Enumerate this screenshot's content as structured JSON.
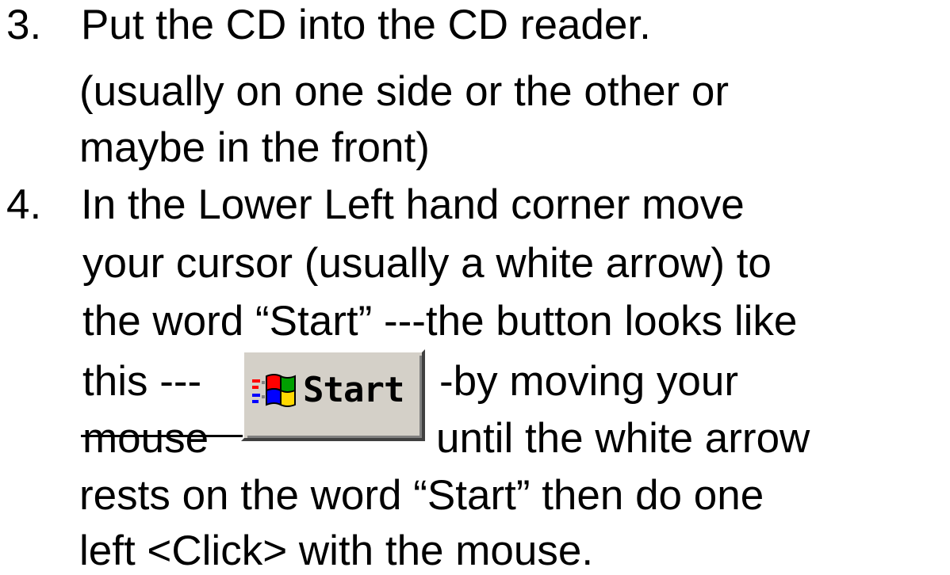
{
  "steps": [
    {
      "number": "3.",
      "lines": [
        "Put the CD into the CD reader.",
        "(usually on one side or the other or",
        "maybe in the front)"
      ]
    },
    {
      "number": "4.",
      "lines": [
        "In the Lower Left hand corner move",
        "your cursor (usually a white arrow) to",
        "the word “Start” ---the button looks like",
        "this ---",
        "-by moving your",
        "mouse",
        "until the white arrow",
        "rests on the word “Start” then do one",
        "left <Click> with the mouse."
      ]
    }
  ],
  "start_button": {
    "label": "Start",
    "icon": "windows-flag-icon"
  },
  "colors": {
    "text": "#000000",
    "background": "#ffffff",
    "button_face": "#d4d0c8"
  }
}
